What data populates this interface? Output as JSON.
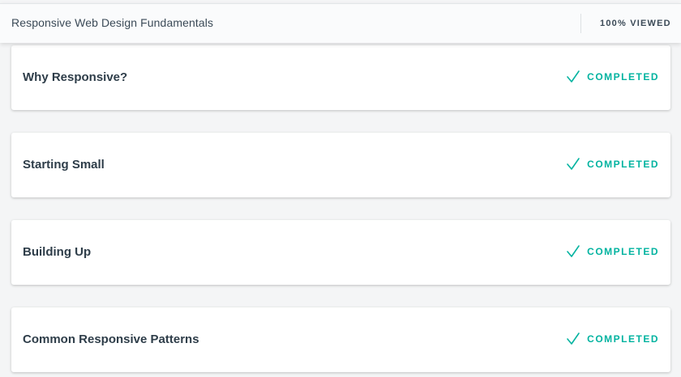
{
  "header": {
    "course_title": "Responsive Web Design Fundamentals",
    "viewed_label": "100% VIEWED"
  },
  "lessons": [
    {
      "title": "Why Responsive?",
      "status": "COMPLETED"
    },
    {
      "title": "Starting Small",
      "status": "COMPLETED"
    },
    {
      "title": "Building Up",
      "status": "COMPLETED"
    },
    {
      "title": "Common Responsive Patterns",
      "status": "COMPLETED"
    }
  ],
  "icons": {
    "status_icon": "check-icon"
  },
  "colors": {
    "completed": "#02b3a0",
    "text": "#2e3d49"
  }
}
